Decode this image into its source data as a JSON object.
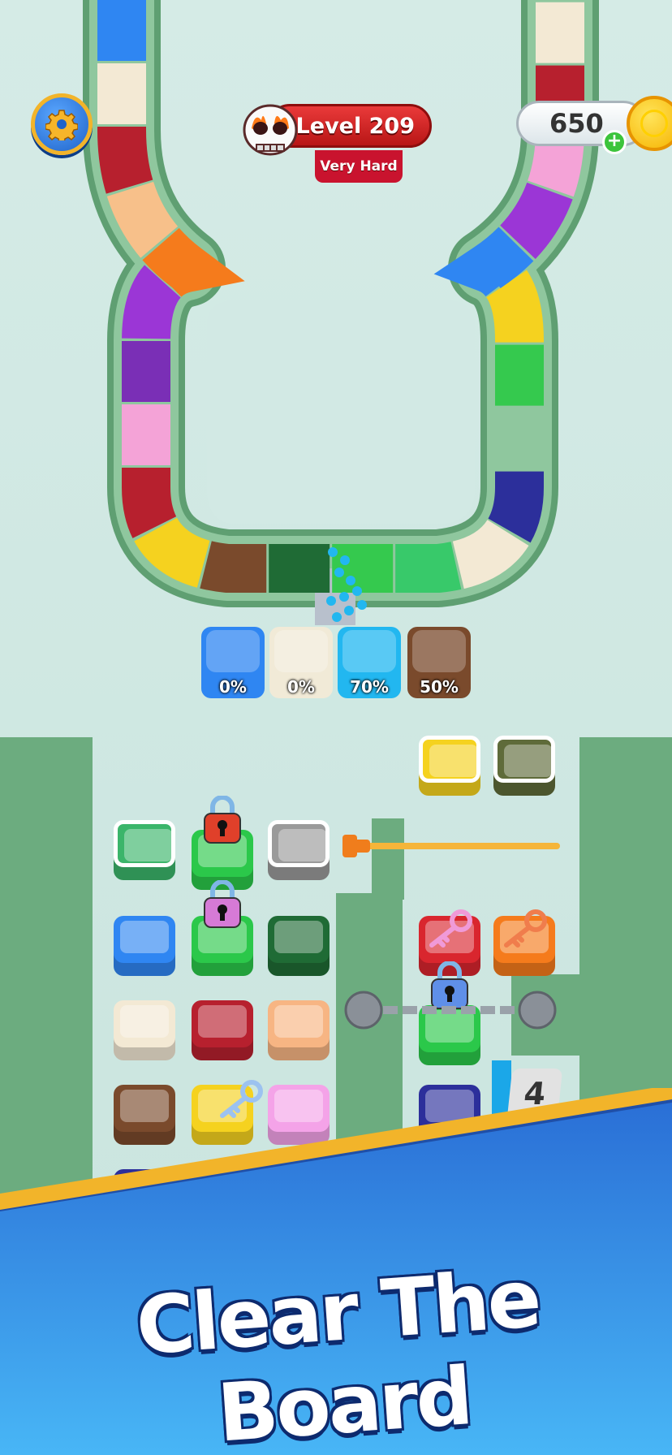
{
  "hud": {
    "level_label": "Level 209",
    "difficulty": "Very Hard",
    "coins": "650",
    "settings_icon": "gear-icon",
    "difficulty_icon": "flaming-skull-icon",
    "coin_icon": "coin-icon",
    "add_coins_icon": "plus-icon"
  },
  "collectors": [
    {
      "color": "#2f86f2",
      "percent": "0%"
    },
    {
      "color": "#f1ead7",
      "percent": "0%"
    },
    {
      "color": "#22b7f0",
      "percent": "70%"
    },
    {
      "color": "#7a4a2c",
      "percent": "50%"
    }
  ],
  "belt_colors": [
    "#2f86f2",
    "#f3e9d4",
    "#b7202e",
    "#f7c08a",
    "#f57b1c",
    "#9b36d6",
    "#7a2fb6",
    "#f4a3d7",
    "#b7202e",
    "#f5d21f",
    "#7a4a2c",
    "#1f6b35",
    "#35c94e",
    "#38c96a",
    "#f3e9d4",
    "#2c2f9b",
    "#22b7f0",
    "#35c94e",
    "#f5d21f",
    "#2f86f2",
    "#9b36d6",
    "#f4a3d7",
    "#b7202e",
    "#f3e9d4"
  ],
  "board": {
    "count_badge": "4",
    "key_icon": "key-icon",
    "lock_icon": "padlock-icon",
    "chain_icon": "chain-icon",
    "pin_icon": "pull-pin-icon"
  },
  "banner": {
    "title": "Clear The Board",
    "colors": {
      "banner_top": "#2a6fd6",
      "banner_bottom": "#48b6f6",
      "stripe": "#f2b42a"
    }
  }
}
